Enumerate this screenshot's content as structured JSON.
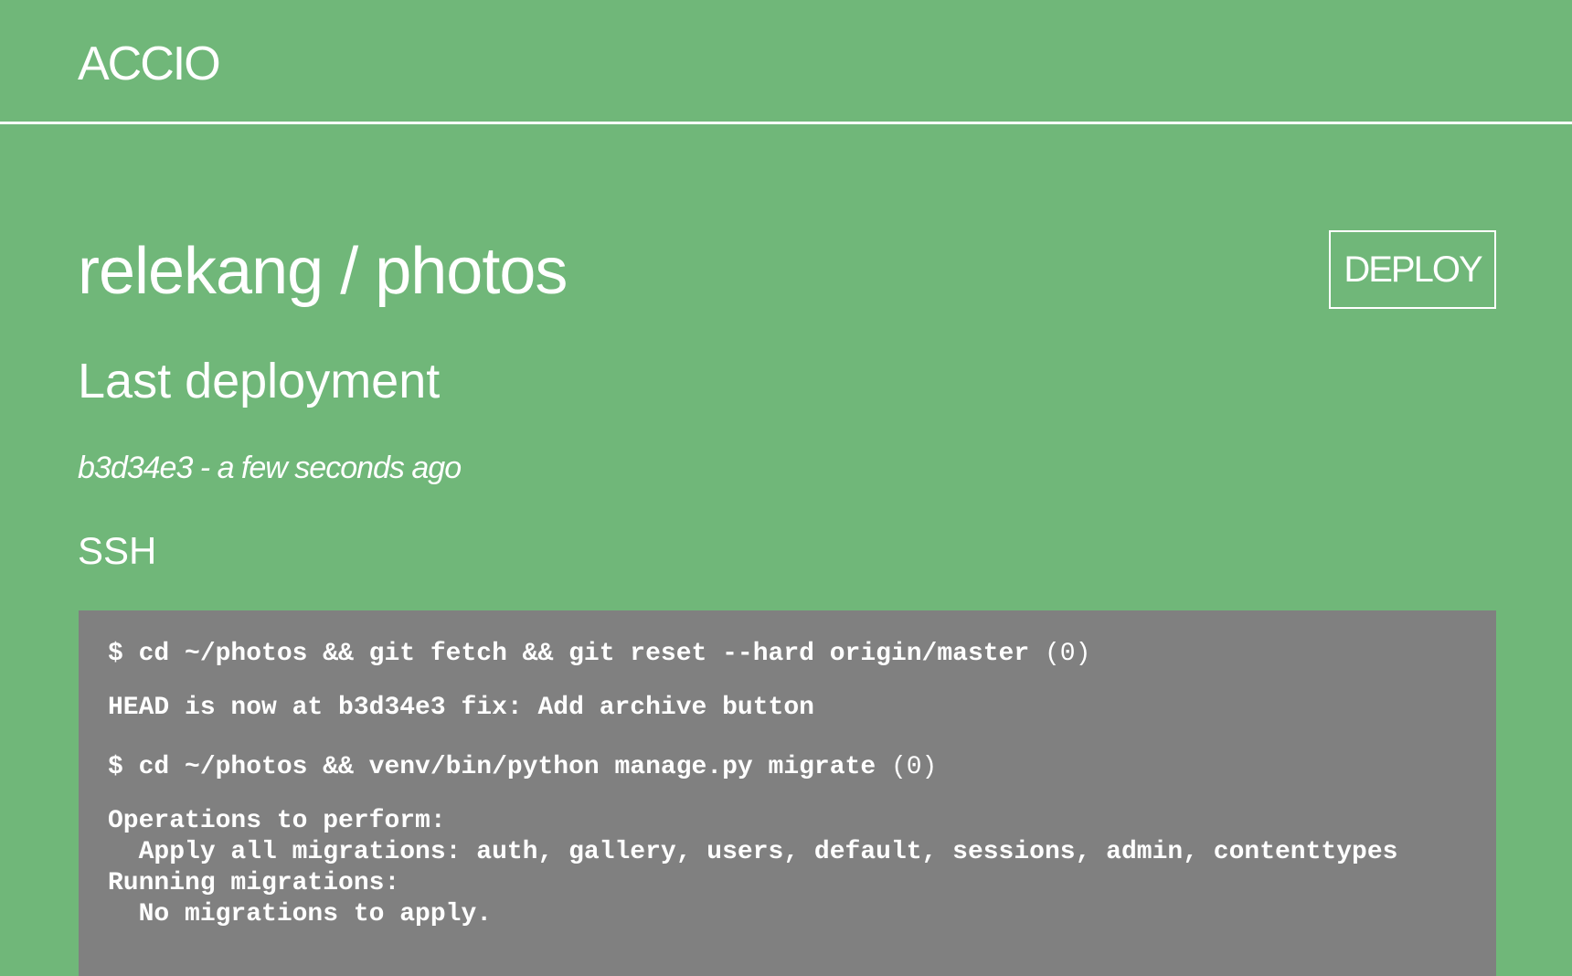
{
  "header": {
    "brand": "ACCIO"
  },
  "repo": {
    "title": "relekang / photos",
    "deploy_label": "DEPLOY"
  },
  "deployment": {
    "heading": "Last deployment",
    "commit_meta": "b3d34e3 - a few seconds ago",
    "ssh_label": "SSH"
  },
  "terminal": {
    "steps": [
      {
        "command": "$ cd ~/photos && git fetch && git reset --hard origin/master",
        "exit_code": "(0)",
        "output": "HEAD is now at b3d34e3 fix: Add archive button"
      },
      {
        "command": "$ cd ~/photos && venv/bin/python manage.py migrate",
        "exit_code": "(0)",
        "output": "Operations to perform:\n  Apply all migrations: auth, gallery, users, default, sessions, admin, contenttypes\nRunning migrations:\n  No migrations to apply."
      }
    ]
  }
}
